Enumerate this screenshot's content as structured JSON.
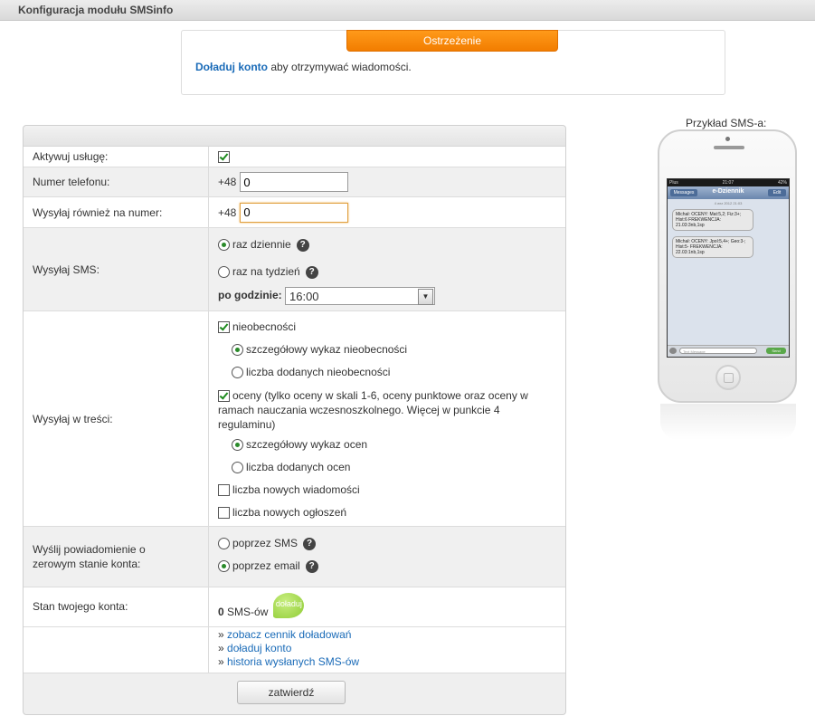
{
  "window": {
    "title": "Konfiguracja modułu SMSinfo"
  },
  "warning": {
    "tab_label": "Ostrzeżenie",
    "link_text": "Doładuj konto",
    "message_rest": " aby otrzymywać wiadomości."
  },
  "form": {
    "activate": {
      "label": "Aktywuj usługę:",
      "checked": true
    },
    "phone": {
      "label": "Numer telefonu:",
      "prefix": "+48",
      "value": "0"
    },
    "phone2": {
      "label": "Wysyłaj również na numer:",
      "prefix": "+48",
      "value": "0"
    },
    "send_sms": {
      "label": "Wysyłaj SMS:",
      "daily": "raz dziennie",
      "weekly": "raz na tydzień",
      "at_hour_label": "po godzinie:",
      "hour_value": "16:00"
    },
    "content": {
      "label": "Wysyłaj w treści:",
      "absences": "nieobecności",
      "absences_detailed": "szczegółowy wykaz nieobecności",
      "absences_count": "liczba dodanych nieobecności",
      "grades": "oceny (tylko oceny w skali 1-6, oceny punktowe oraz oceny w ramach nauczania wczesnoszkolnego. Więcej w punkcie 4 regulaminu)",
      "grades_detailed": "szczegółowy wykaz ocen",
      "grades_count": "liczba dodanych ocen",
      "new_messages": "liczba nowych wiadomości",
      "new_announcements": "liczba nowych ogłoszeń"
    },
    "zero_notify": {
      "label": "Wyślij powiadomienie o zerowym stanie konta:",
      "by_sms": "poprzez SMS",
      "by_email": "poprzez email"
    },
    "balance": {
      "label": "Stan twojego konta:",
      "count": "0",
      "unit": " SMS-ów",
      "topup_badge": "doładuj"
    },
    "links": {
      "prefix": "» ",
      "pricing": "zobacz cennik doładowań",
      "topup": "doładuj konto",
      "history": "historia wysłanych SMS-ów"
    },
    "submit_label": "zatwierdź"
  },
  "preview": {
    "label": "Przykład SMS-a:",
    "status_left": "Plus",
    "status_time": "21:07",
    "status_right": "42%",
    "back_label": "Messages",
    "app_title": "e-Dziennik",
    "edit_label": "Edit",
    "date_line": "4 wrz 2012 21:03",
    "bubble1": "Michał: OCENY: Mat:5,2; Fiz:3+; Hist:6 FREKWENCJA: 21.03:3nb,1sp",
    "bubble2": "Michał: OCENY: Jpol:5,4+; Geo:3-; Hist:5- FREKWENCJA: 22.03:1nb,1sp",
    "composer_placeholder": "Text Message",
    "send_label": "Send"
  },
  "colors": {
    "accent_orange": "#f27d00",
    "link_blue": "#1a6bb8",
    "check_green": "#1d8a1d"
  }
}
